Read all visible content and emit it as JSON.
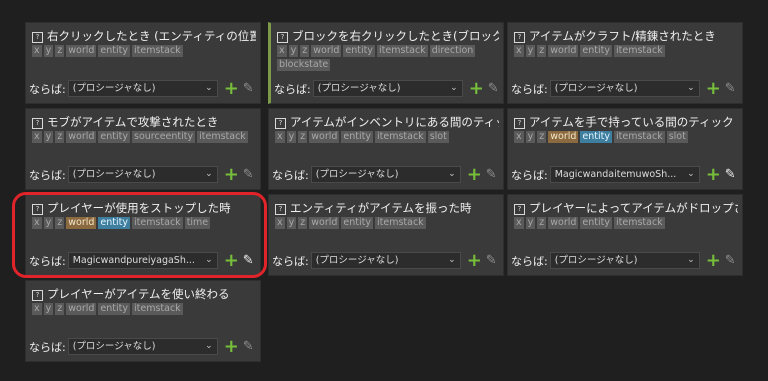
{
  "cards": [
    {
      "title": "右クリックしたとき (エンティティの位置)",
      "tags": [
        "x",
        "y",
        "z",
        "world",
        "entity",
        "itemstack"
      ],
      "label": "ならば:",
      "select": "(プロシージャなし)",
      "pen_active": false
    },
    {
      "title": "ブロックを右クリックしたとき(ブロックの座標)",
      "tags": [
        "x",
        "y",
        "z",
        "world",
        "entity",
        "itemstack",
        "direction",
        "blockstate"
      ],
      "label": "ならば:",
      "select": "(プロシージャなし)",
      "pen_active": false
    },
    {
      "title": "アイテムがクラフト/精錬されたとき",
      "tags": [
        "x",
        "y",
        "z",
        "world",
        "entity",
        "itemstack"
      ],
      "label": "ならば:",
      "select": "(プロシージャなし)",
      "pen_active": false
    },
    {
      "title": "モブがアイテムで攻撃されたとき",
      "tags": [
        "x",
        "y",
        "z",
        "world",
        "entity",
        "sourceentity",
        "itemstack"
      ],
      "label": "ならば:",
      "select": "(プロシージャなし)",
      "pen_active": false
    },
    {
      "title": "アイテムがインベントリにある間のティック",
      "tags": [
        "x",
        "y",
        "z",
        "world",
        "entity",
        "itemstack",
        "slot"
      ],
      "label": "ならば:",
      "select": "(プロシージャなし)",
      "pen_active": false
    },
    {
      "title": "アイテムを手で持っている間のティック",
      "tags": [
        "x",
        "y",
        "z",
        "world",
        "entity",
        "itemstack",
        "slot"
      ],
      "label": "ならば:",
      "select": "MagicwandaitemuwoSh...",
      "pen_active": true
    },
    {
      "title": "プレイヤーが使用をストップした時",
      "tags": [
        "x",
        "y",
        "z",
        "world",
        "entity",
        "itemstack",
        "time"
      ],
      "label": "ならば:",
      "select": "MagicwandpureiyagaSh...",
      "pen_active": true
    },
    {
      "title": "エンティティがアイテムを振った時",
      "tags": [
        "x",
        "y",
        "z",
        "world",
        "entity",
        "itemstack"
      ],
      "label": "ならば:",
      "select": "(プロシージャなし)",
      "pen_active": false
    },
    {
      "title": "プレイヤーによってアイテムがドロップされたとき",
      "tags": [
        "x",
        "y",
        "z",
        "world",
        "entity",
        "itemstack"
      ],
      "label": "ならば:",
      "select": "(プロシージャなし)",
      "pen_active": false
    },
    {
      "title": "プレイヤーがアイテムを使い終わる",
      "tags": [
        "x",
        "y",
        "z",
        "world",
        "entity",
        "itemstack"
      ],
      "label": "ならば:",
      "select": "(プロシージャなし)",
      "pen_active": false
    }
  ],
  "icons": {
    "question": "?",
    "chevron": "⌄",
    "plus": "+",
    "pen": "✎"
  },
  "colors": {
    "accent_plus": "#77bf3a",
    "highlight": "#e0242a",
    "tag_world_used": "#8a6a3e",
    "tag_entity_used": "#3e7fa0"
  }
}
